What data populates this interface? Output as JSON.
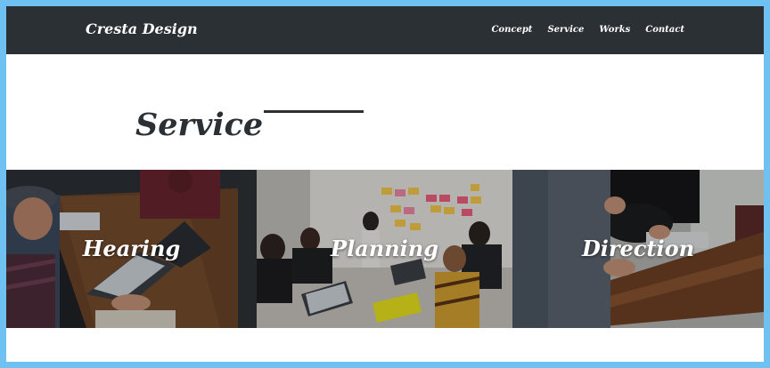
{
  "header": {
    "logo": "Cresta Design",
    "nav": [
      "Concept",
      "Service",
      "Works",
      "Contact"
    ]
  },
  "section": {
    "title": "Service"
  },
  "cards": [
    {
      "label": "Hearing"
    },
    {
      "label": "Planning"
    },
    {
      "label": "Direction"
    }
  ],
  "colors": {
    "outer_border": "#6ec1f1",
    "header_bg": "#2b3035",
    "title_text": "#2b3035",
    "page_bg": "#ffffff"
  }
}
